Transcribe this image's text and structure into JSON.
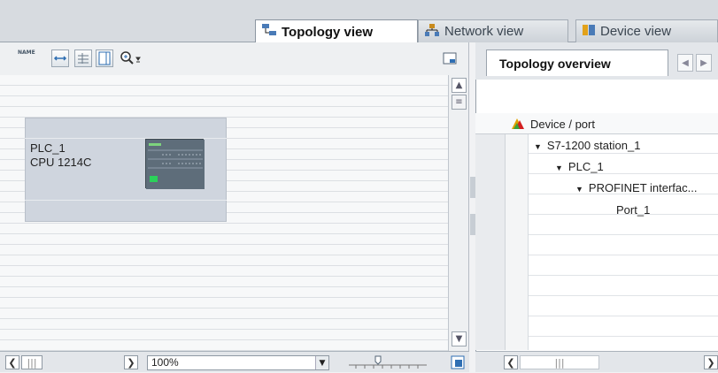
{
  "tabs": {
    "topology": "Topology view",
    "network": "Network view",
    "device": "Device view"
  },
  "toolbar": {
    "name_icon_label": "NAME"
  },
  "device": {
    "name": "PLC_1",
    "type": "CPU 1214C"
  },
  "status": {
    "zoom_value": "100%"
  },
  "overview": {
    "tab_title": "Topology overview",
    "column_header": "Device / port",
    "tree": [
      {
        "label": "S7-1200 station_1",
        "level": 0,
        "expanded": true
      },
      {
        "label": "PLC_1",
        "level": 1,
        "expanded": true
      },
      {
        "label": "PROFINET interfac...",
        "level": 2,
        "expanded": true
      },
      {
        "label": "Port_1",
        "level": 3,
        "expanded": false
      }
    ]
  },
  "colors": {
    "device_fill": "#cfd5de",
    "plc_led": "#2bd15a",
    "active_tab_bg": "#ffffff"
  },
  "icons": [
    "topology-view-icon",
    "network-view-icon",
    "device-view-icon",
    "name-icon",
    "fit-icon",
    "grid-icon",
    "page-icon",
    "zoom-icon",
    "overview-navigation-icon",
    "warning-legend-icon"
  ]
}
